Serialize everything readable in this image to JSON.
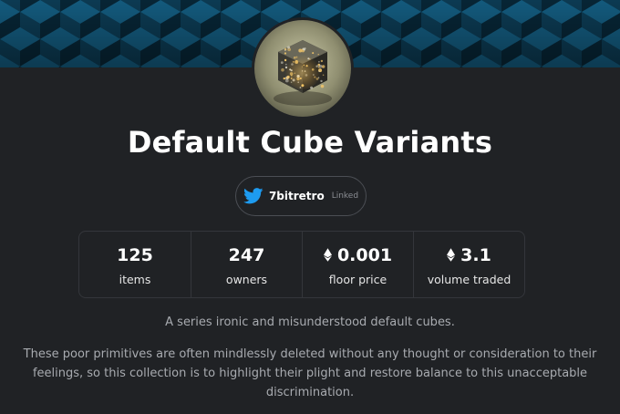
{
  "collection": {
    "title": "Default Cube Variants",
    "avatar_icon": "cube-artwork",
    "banner_icon": "cube-pattern-banner"
  },
  "creator": {
    "icon": "twitter-bird-icon",
    "name": "7bitretro",
    "status": "Linked",
    "brand_color": "#1d9bf0"
  },
  "stats": [
    {
      "value": "125",
      "label": "items",
      "icon": null
    },
    {
      "value": "247",
      "label": "owners",
      "icon": null
    },
    {
      "value": "0.001",
      "label": "floor price",
      "icon": "ethereum-icon"
    },
    {
      "value": "3.1",
      "label": "volume traded",
      "icon": "ethereum-icon"
    }
  ],
  "description": "A series ironic and misunderstood default cubes.",
  "long_description": "These poor primitives are often mindlessly deleted without any thought or consideration to their feelings, so this collection is to highlight their plight and restore balance to this unacceptable discrimination.",
  "colors": {
    "background": "#202225",
    "banner_dark": "#0b2430",
    "banner_cube": "#0f4a68",
    "text_muted": "#a8abb0"
  }
}
